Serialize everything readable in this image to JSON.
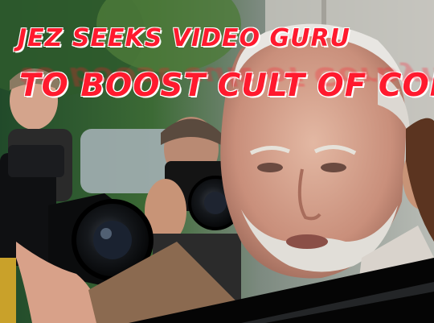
{
  "headline": {
    "line1": "Jez seeks video guru",
    "line2": "to boost cult of Corbyn"
  },
  "colors": {
    "headline_text": "#ff1a2e",
    "headline_outline": "#ffffff"
  }
}
